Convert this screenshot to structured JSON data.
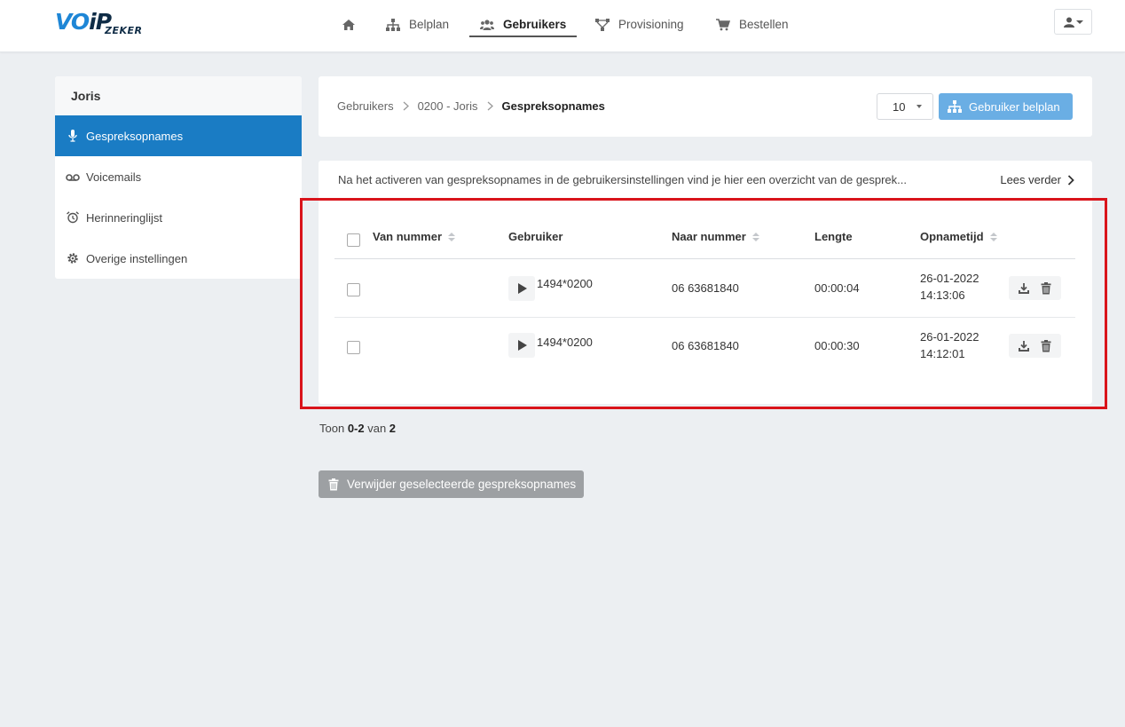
{
  "logo": {
    "main_a": "VO",
    "main_b": "iP",
    "sub": "ZEKER"
  },
  "nav": {
    "home_icon": "home-icon",
    "items": [
      {
        "label": "Belplan",
        "icon": "sitemap-icon"
      },
      {
        "label": "Gebruikers",
        "icon": "users-icon"
      },
      {
        "label": "Provisioning",
        "icon": "network-icon"
      },
      {
        "label": "Bestellen",
        "icon": "cart-icon"
      }
    ],
    "user_menu_icon": "user-icon"
  },
  "sidebar": {
    "title": "Joris",
    "items": [
      {
        "label": "Gespreksopnames",
        "icon": "microphone-icon",
        "active": true
      },
      {
        "label": "Voicemails",
        "icon": "voicemail-icon"
      },
      {
        "label": "Herinneringlijst",
        "icon": "alarm-clock-icon"
      },
      {
        "label": "Overige instellingen",
        "icon": "gear-icon"
      }
    ]
  },
  "breadcrumb": {
    "items": [
      "Gebruikers",
      "0200 - Joris",
      "Gespreksopnames"
    ]
  },
  "page_size": {
    "value": "10"
  },
  "belplan_button": {
    "label": "Gebruiker belplan"
  },
  "info": {
    "text": "Na het activeren van gespreksopnames in de gebruikersinstellingen vind je hier een overzicht van de gesprek...",
    "read_more": "Lees verder"
  },
  "table": {
    "columns": [
      "Van nummer",
      "Gebruiker",
      "Naar nummer",
      "Lengte",
      "Opnametijd"
    ],
    "rows": [
      {
        "van": "",
        "gebruiker": "1494*0200",
        "naar": "06  63681840",
        "lengte": "00:00:04",
        "datum": "26-01-2022",
        "tijd": "14:13:06"
      },
      {
        "van": "",
        "gebruiker": "1494*0200",
        "naar": "06  63681840",
        "lengte": "00:00:30",
        "datum": "26-01-2022",
        "tijd": "14:12:01"
      }
    ]
  },
  "summary": {
    "prefix": "Toon ",
    "range": "0-2",
    "middle": " van ",
    "total": "2"
  },
  "delete_button": {
    "label": "Verwijder geselecteerde gespreksopnames"
  },
  "colors": {
    "accent": "#1a7cc4",
    "highlight": "#d9141b",
    "button_light": "#6aaee4"
  }
}
